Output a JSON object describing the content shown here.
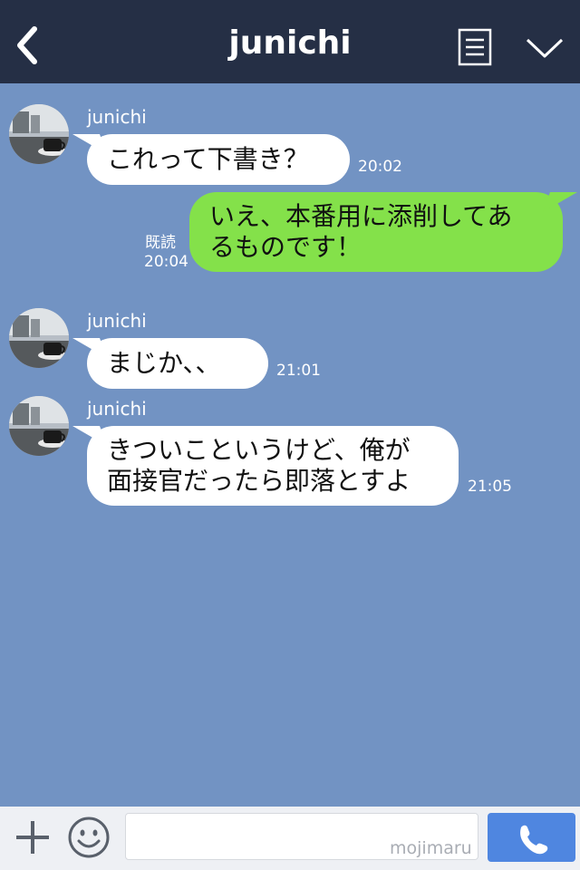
{
  "header": {
    "title": "junichi",
    "back_icon": "chevron-left-icon",
    "menu_icon": "list-menu-icon",
    "fold_icon": "chevron-down-icon"
  },
  "messages": [
    {
      "sender": "junichi",
      "text": "これって下書き？",
      "time": "20:02"
    },
    {
      "text_line1": "いえ、本番用に添削してあ",
      "text_line2": "るものです！",
      "read": "既読",
      "time": "20:04"
    },
    {
      "sender": "junichi",
      "text": "まじか、、",
      "time": "21:01"
    },
    {
      "sender": "junichi",
      "text_line1": "きついこというけど、俺が",
      "text_line2": "面接官だったら即落とすよ",
      "time": "21:05"
    }
  ],
  "footer": {
    "plus_icon": "plus-icon",
    "emoji_icon": "smiley-icon",
    "input_value": "",
    "watermark": "mojimaru",
    "call_icon": "phone-icon"
  },
  "colors": {
    "header_bg": "#252f45",
    "chat_bg": "#7293c3",
    "outgoing_bubble": "#84e14a",
    "incoming_bubble": "#ffffff",
    "call_button": "#4f86e0"
  }
}
